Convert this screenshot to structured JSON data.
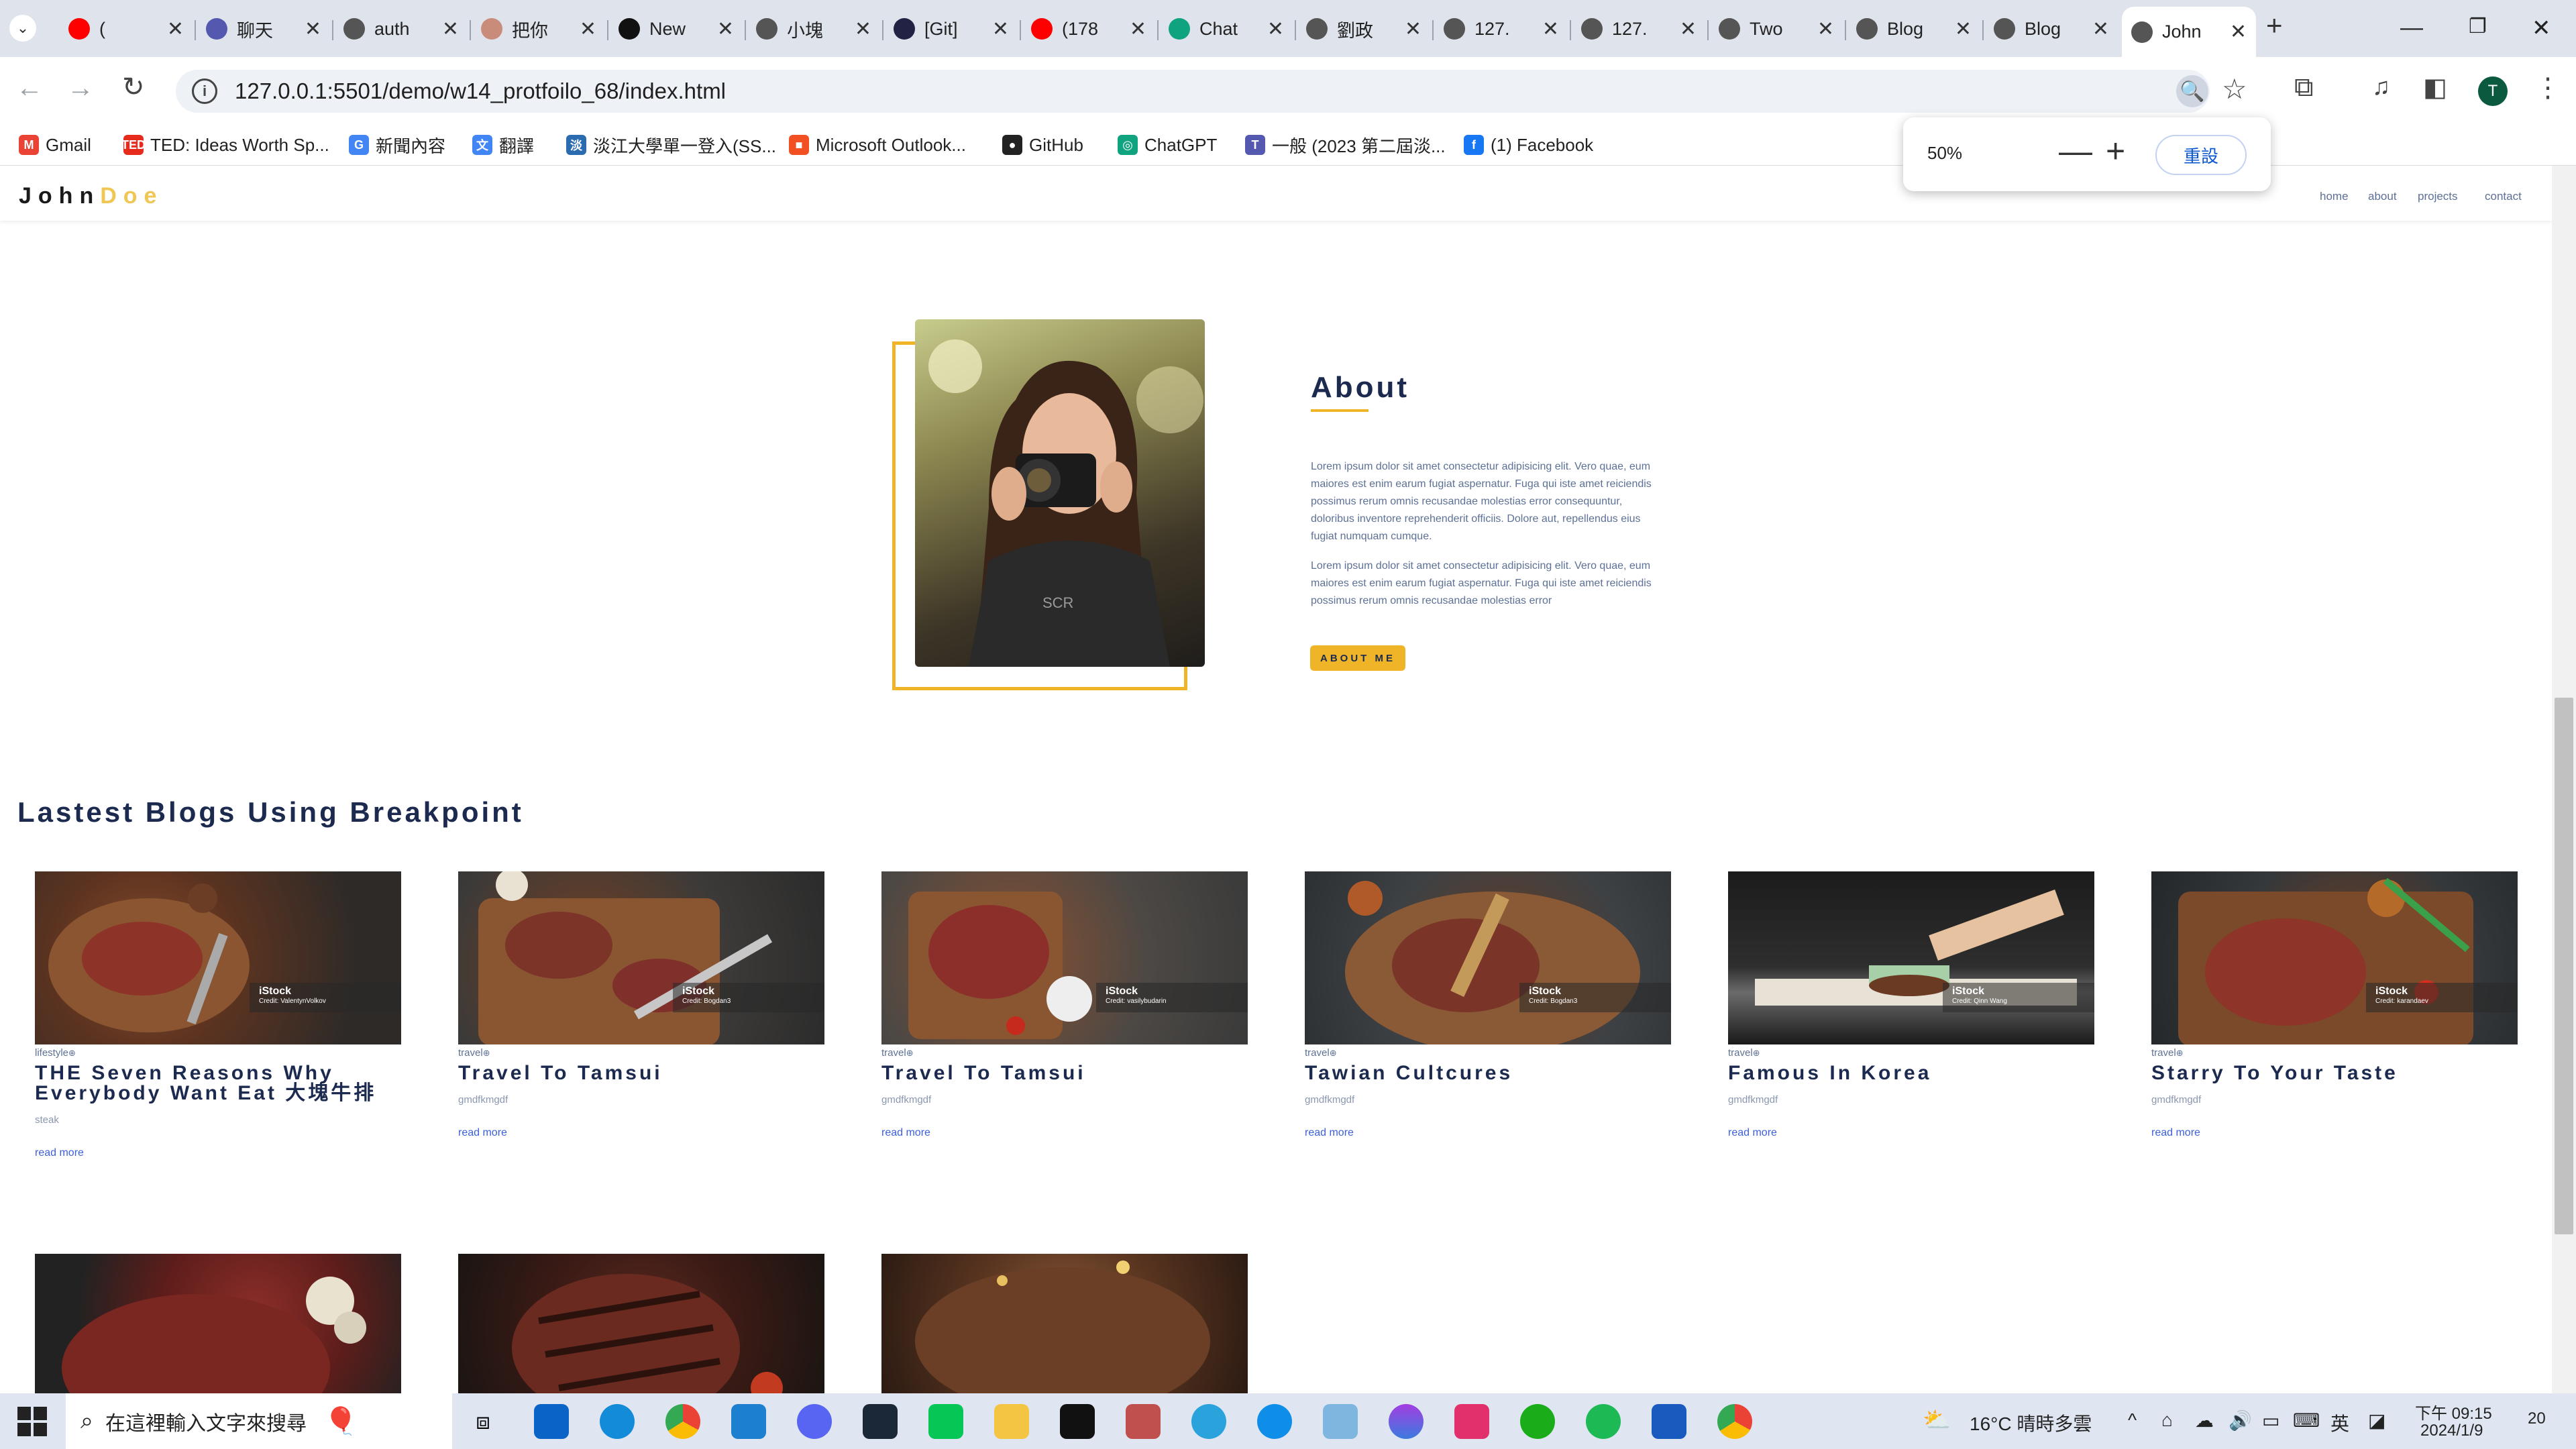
{
  "browser": {
    "tabs": [
      {
        "title": "(",
        "icon_color": "#ff0000",
        "icon": "youtube-icon"
      },
      {
        "title": "聊天",
        "icon_color": "#5558af",
        "icon": "teams-icon"
      },
      {
        "title": "auth",
        "icon_color": "#555555",
        "icon": "globe-icon"
      },
      {
        "title": "把你",
        "icon_color": "#c98b7a",
        "icon": "page-icon"
      },
      {
        "title": "New",
        "icon_color": "#111111",
        "icon": "app-icon"
      },
      {
        "title": "小塊",
        "icon_color": "#555555",
        "icon": "globe-icon"
      },
      {
        "title": "[Git]",
        "icon_color": "#222244",
        "icon": "git-icon"
      },
      {
        "title": "(178",
        "icon_color": "#ff0000",
        "icon": "youtube-icon"
      },
      {
        "title": "Chat",
        "icon_color": "#10a37f",
        "icon": "chatgpt-icon"
      },
      {
        "title": "劉政",
        "icon_color": "#555555",
        "icon": "globe-icon"
      },
      {
        "title": "127.",
        "icon_color": "#555555",
        "icon": "globe-icon"
      },
      {
        "title": "127.",
        "icon_color": "#555555",
        "icon": "globe-icon"
      },
      {
        "title": "Two",
        "icon_color": "#555555",
        "icon": "globe-icon"
      },
      {
        "title": "Blog",
        "icon_color": "#555555",
        "icon": "globe-icon"
      },
      {
        "title": "Blog",
        "icon_color": "#555555",
        "icon": "globe-icon"
      },
      {
        "title": "John",
        "icon_color": "#555555",
        "icon": "globe-icon",
        "active": true
      }
    ],
    "url": "127.0.0.1:5501/demo/w14_protfoilo_68/index.html",
    "bookmarks": [
      {
        "label": "Gmail",
        "icon_color": "#ea4335",
        "icon": "gmail-icon",
        "glyph": "M"
      },
      {
        "label": "TED: Ideas Worth Sp...",
        "icon_color": "#e62b1e",
        "icon": "ted-icon",
        "glyph": "TED"
      },
      {
        "label": "新聞內容",
        "icon_color": "#4285f4",
        "icon": "news-icon",
        "glyph": "G"
      },
      {
        "label": "翻譯",
        "icon_color": "#4285f4",
        "icon": "translate-icon",
        "glyph": "文"
      },
      {
        "label": "淡江大學單一登入(SS...",
        "icon_color": "#2b6cb0",
        "icon": "tku-icon",
        "glyph": "淡"
      },
      {
        "label": "Microsoft Outlook...",
        "icon_color": "#f25022",
        "icon": "microsoft-icon",
        "glyph": "■"
      },
      {
        "label": "GitHub",
        "icon_color": "#222222",
        "icon": "github-icon",
        "glyph": "●"
      },
      {
        "label": "ChatGPT",
        "icon_color": "#10a37f",
        "icon": "chatgpt-icon",
        "glyph": "◎"
      },
      {
        "label": "一般 (2023 第二屆淡...",
        "icon_color": "#5558af",
        "icon": "teams-icon",
        "glyph": "T"
      },
      {
        "label": "(1) Facebook",
        "icon_color": "#1877f2",
        "icon": "facebook-icon",
        "glyph": "f"
      }
    ],
    "zoom": {
      "value": "50%",
      "minus": "—",
      "plus": "+",
      "reset": "重設"
    },
    "profile_initial": "T"
  },
  "site": {
    "logo_first": "John",
    "logo_last": "Doe",
    "nav": [
      "home",
      "about",
      "projects",
      "contact"
    ],
    "about": {
      "title": "About",
      "p1": "Lorem ipsum dolor sit amet consectetur adipisicing elit. Vero quae, eum maiores est enim earum fugiat aspernatur. Fuga qui iste amet reiciendis possimus rerum omnis recusandae molestias error consequuntur, doloribus inventore reprehenderit officiis. Dolore aut, repellendus eius fugiat numquam cumque.",
      "p2": "Lorem ipsum dolor sit amet consectetur adipisicing elit. Vero quae, eum maiores est enim earum fugiat aspernatur. Fuga qui iste amet reiciendis possimus rerum omnis recusandae molestias error",
      "button": "ABOUT ME"
    },
    "blogs_title": "Lastest Blogs Using Breakpoint",
    "cards": [
      {
        "category": "lifestyle",
        "title": "THE Seven Reasons Why Everybody Want Eat 大塊牛排",
        "desc": "steak",
        "more": "read more",
        "credit": "Credit: ValentynVolkov"
      },
      {
        "category": "travel",
        "title": "Travel To Tamsui",
        "desc": "gmdfkmgdf",
        "more": "read more",
        "credit": "Credit: Bogdan3"
      },
      {
        "category": "travel",
        "title": "Travel To Tamsui",
        "desc": "gmdfkmgdf",
        "more": "read more",
        "credit": "Credit: vasilybudarin"
      },
      {
        "category": "travel",
        "title": "Tawian Cultcures",
        "desc": "gmdfkmgdf",
        "more": "read more",
        "credit": "Credit: Bogdan3"
      },
      {
        "category": "travel",
        "title": "Famous In Korea",
        "desc": "gmdfkmgdf",
        "more": "read more",
        "credit": "Credit: Qinn Wang"
      },
      {
        "category": "travel",
        "title": "Starry To Your Taste",
        "desc": "gmdfkmgdf",
        "more": "read more",
        "credit": "Credit: karandaev"
      }
    ],
    "watermark": "iStock"
  },
  "taskbar": {
    "search_placeholder": "在這裡輸入文字來搜尋",
    "weather": "16°C 晴時多雲",
    "ime": "英",
    "time": "下午 09:15",
    "date": "2024/1/9",
    "notifications": "20"
  }
}
